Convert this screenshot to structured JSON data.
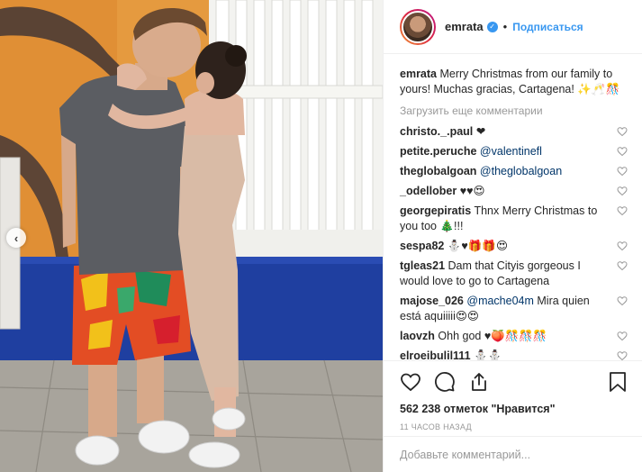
{
  "post": {
    "username": "emrata",
    "follow_label": "Подписаться",
    "dot": "•",
    "caption": "Merry Christmas from our family to yours! Muchas gracias, Cartagena! ✨🥂🎊"
  },
  "comments_section": {
    "load_more": "Загрузить еще комментарии",
    "items": [
      {
        "user": "christo._.paul",
        "mention": "",
        "text": "❤"
      },
      {
        "user": "petite.peruche",
        "mention": "@valentinefl",
        "text": ""
      },
      {
        "user": "theglobalgoan",
        "mention": "@theglobalgoan",
        "text": ""
      },
      {
        "user": "_odellober",
        "mention": "",
        "text": "♥♥😍"
      },
      {
        "user": "georgepiratis",
        "mention": "",
        "text": "Thnx Merry Christmas to you too 🎄!!!"
      },
      {
        "user": "sespa82",
        "mention": "",
        "text": "⛄♥🎁🎁😍"
      },
      {
        "user": "tgleas21",
        "mention": "",
        "text": "Dam that Cityis gorgeous I would love to go to Cartagena"
      },
      {
        "user": "majose_026",
        "mention": "@mache04m",
        "text": "Mira quien está aquiiiii😍😍"
      },
      {
        "user": "laovzh",
        "mention": "",
        "text": "Ohh god ♥🍑🎊🎊🎊"
      },
      {
        "user": "elroeibulil111",
        "mention": "",
        "text": "⛄⛄"
      }
    ]
  },
  "stats": {
    "likes": "562 238 отметок \"Нравится\"",
    "time_ago": "11 часов назад"
  },
  "add_comment": {
    "placeholder": "Добавьте комментарий..."
  },
  "colors": {
    "link_blue": "#3897f0",
    "mention_blue": "#003569",
    "muted": "#999999"
  },
  "icons": [
    "heart-icon",
    "comment-icon",
    "share-icon",
    "bookmark-icon",
    "verified-badge-icon",
    "chevron-left-icon"
  ]
}
